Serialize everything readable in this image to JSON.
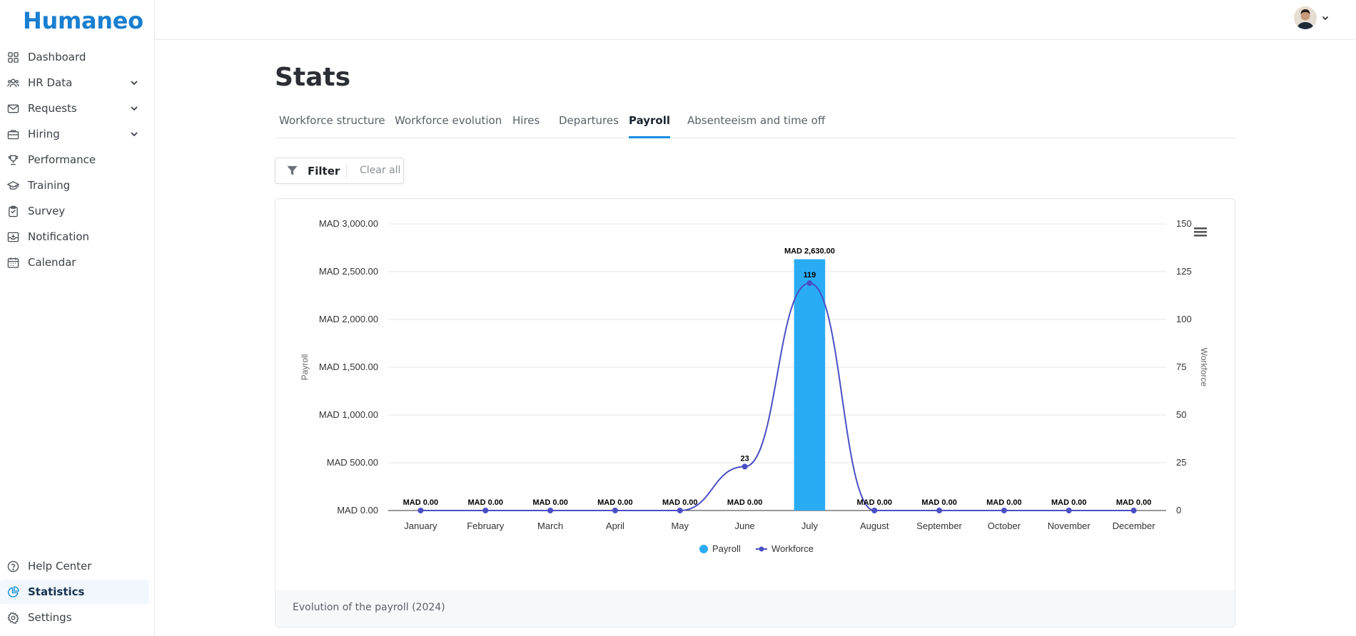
{
  "app": {
    "logo": "Humaneo"
  },
  "sidebar": {
    "items": [
      {
        "label": "Dashboard",
        "icon": "grid-icon"
      },
      {
        "label": "HR Data",
        "icon": "users-icon",
        "expandable": true
      },
      {
        "label": "Requests",
        "icon": "mail-icon",
        "expandable": true
      },
      {
        "label": "Hiring",
        "icon": "briefcase-icon",
        "expandable": true
      },
      {
        "label": "Performance",
        "icon": "trophy-icon"
      },
      {
        "label": "Training",
        "icon": "graduation-cap-icon"
      },
      {
        "label": "Survey",
        "icon": "clipboard-icon"
      },
      {
        "label": "Notification",
        "icon": "inbox-icon"
      },
      {
        "label": "Calendar",
        "icon": "calendar-icon"
      }
    ],
    "bottom_items": [
      {
        "label": "Help Center",
        "icon": "help-circle-icon"
      },
      {
        "label": "Statistics",
        "icon": "pie-chart-icon",
        "active": true
      },
      {
        "label": "Settings",
        "icon": "gear-icon"
      }
    ]
  },
  "header": {
    "avatar_icon": "user-avatar"
  },
  "page": {
    "title": "Stats",
    "tabs": [
      {
        "label": "Workforce structure"
      },
      {
        "label": "Workforce evolution"
      },
      {
        "label": "Hires"
      },
      {
        "label": "Departures"
      },
      {
        "label": "Payroll",
        "active": true
      },
      {
        "label": "Absenteeism and time off"
      }
    ],
    "filter": {
      "label": "Filter",
      "clear_label": "Clear all"
    },
    "chart_caption": "Evolution of the payroll (2024)"
  },
  "colors": {
    "accent": "#1a8fe0",
    "bar": "#2aacf5",
    "line": "#4b4fc4",
    "logo": "#1a7fd0"
  },
  "chart_data": {
    "type": "bar",
    "categories": [
      "January",
      "February",
      "March",
      "April",
      "May",
      "June",
      "July",
      "August",
      "September",
      "October",
      "November",
      "December"
    ],
    "series": [
      {
        "name": "Payroll",
        "type": "bar",
        "axis": "left",
        "values": [
          0,
          0,
          0,
          0,
          0,
          0,
          2630,
          0,
          0,
          0,
          0,
          0
        ],
        "labels": [
          "MAD 0.00",
          "MAD 0.00",
          "MAD 0.00",
          "MAD 0.00",
          "MAD 0.00",
          "MAD 0.00",
          "MAD 2,630.00",
          "MAD 0.00",
          "MAD 0.00",
          "MAD 0.00",
          "MAD 0.00",
          "MAD 0.00"
        ]
      },
      {
        "name": "Workforce",
        "type": "line",
        "axis": "right",
        "values": [
          0,
          0,
          0,
          0,
          0,
          23,
          119,
          0,
          0,
          0,
          0,
          0
        ]
      }
    ],
    "ylabel": "Payroll",
    "y2label": "Workforce",
    "ylim": [
      0,
      3000
    ],
    "y2lim": [
      0,
      150
    ],
    "yticks": [
      "MAD 0.00",
      "MAD 500.00",
      "MAD 1,000.00",
      "MAD 1,500.00",
      "MAD 2,000.00",
      "MAD 2,500.00",
      "MAD 3,000.00"
    ],
    "y2ticks": [
      "0",
      "25",
      "50",
      "75",
      "100",
      "125",
      "150"
    ],
    "legend_position": "bottom-center",
    "grid": true
  }
}
